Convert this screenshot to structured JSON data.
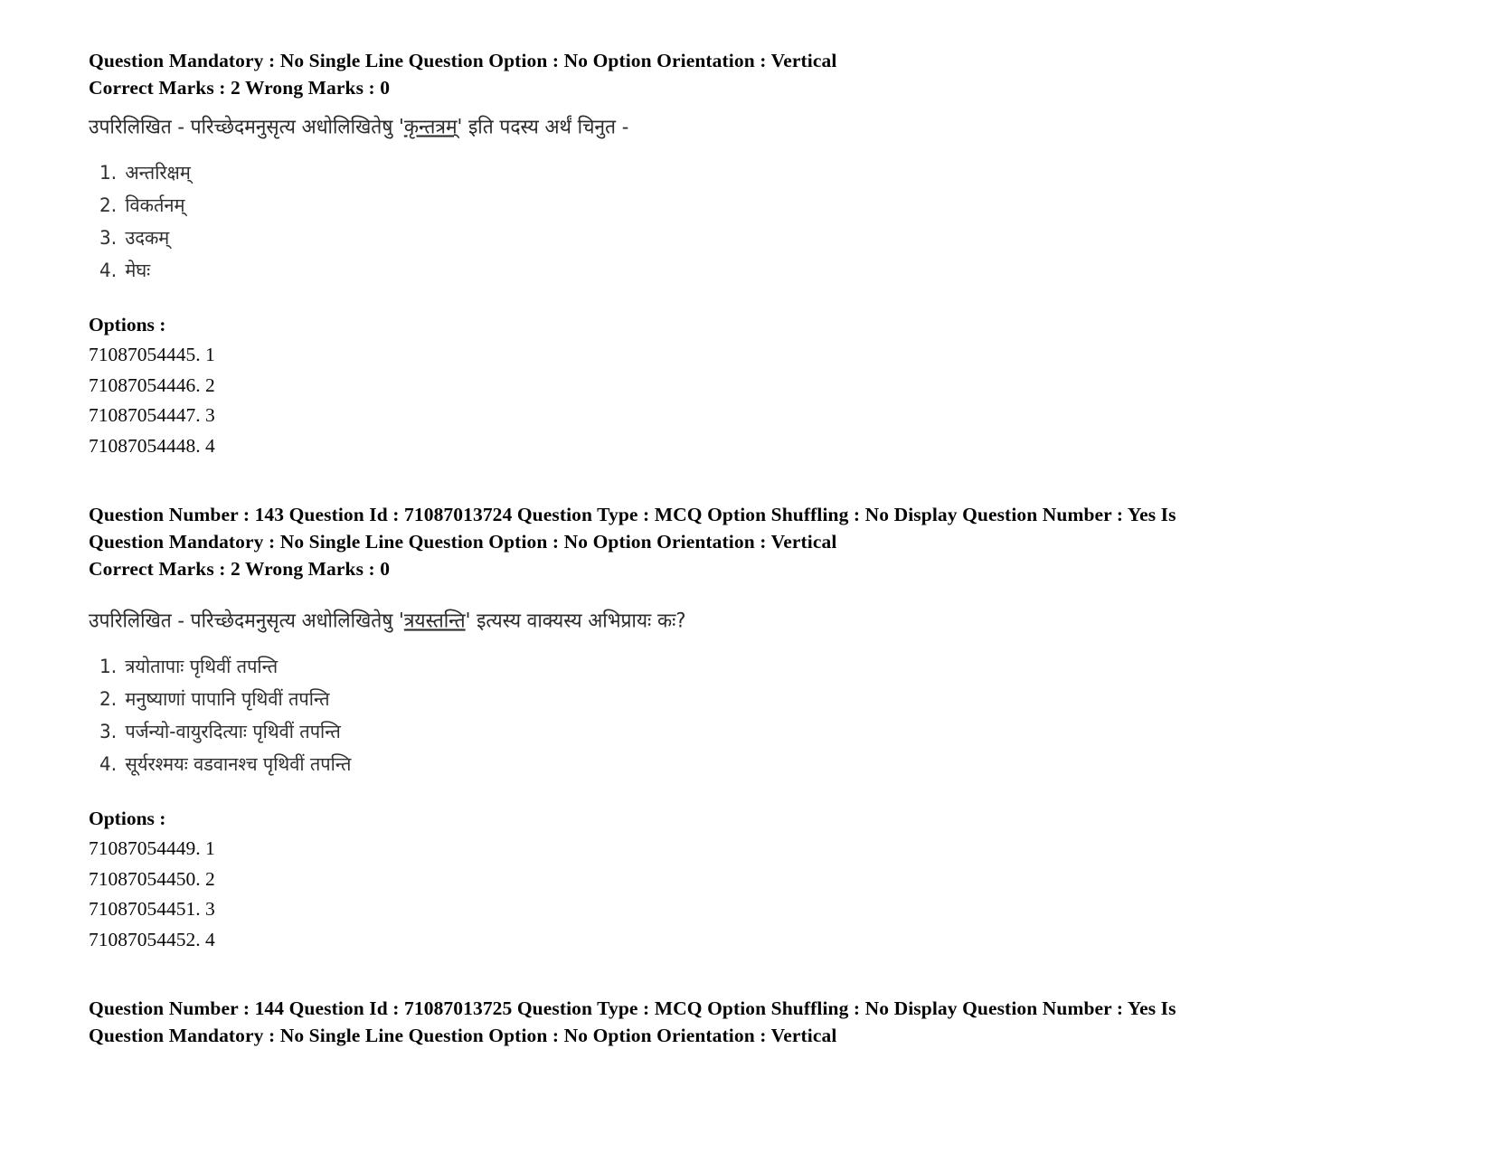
{
  "document": {
    "type": "scanned-exam-question-paper",
    "language_script": "Devanagari (Sanskrit)"
  },
  "blocks": [
    {
      "id": "question-142-tail",
      "meta_lines": [
        "Question Mandatory : No Single Line Question Option : No Option Orientation : Vertical",
        "Correct Marks : 2 Wrong Marks : 0"
      ],
      "stem_prefix": "उपरिलिखित - परिच्छेदमनुसृत्य अधोलिखितेषु '",
      "stem_quoted": "कृन्तत्रम्",
      "stem_suffix": "' इति पदस्य अर्थं चिनुत -",
      "choices": [
        {
          "num": "1.",
          "text": "अन्तरिक्षम्"
        },
        {
          "num": "2.",
          "text": "विकर्तनम्"
        },
        {
          "num": "3.",
          "text": "उदकम्"
        },
        {
          "num": "4.",
          "text": "मेघः"
        }
      ],
      "options_label": "Options :",
      "option_ids": [
        "71087054445. 1",
        "71087054446. 2",
        "71087054447. 3",
        "71087054448. 4"
      ]
    },
    {
      "id": "question-143",
      "meta_lines": [
        "Question Number : 143 Question Id : 71087013724 Question Type : MCQ Option Shuffling : No Display Question Number : Yes Is",
        "Question Mandatory : No Single Line Question Option : No Option Orientation : Vertical",
        "Correct Marks : 2 Wrong Marks : 0"
      ],
      "stem_prefix": "उपरिलिखित - परिच्छेदमनुसृत्य अधोलिखितेषु '",
      "stem_quoted": "त्रयस्तन्ति",
      "stem_suffix": "' इत्यस्य वाक्यस्य अभिप्रायः कः?",
      "choices": [
        {
          "num": "1.",
          "text": "त्रयोतापाः पृथिवीं तपन्ति"
        },
        {
          "num": "2.",
          "text": "मनुष्याणां पापानि पृथिवीं तपन्ति"
        },
        {
          "num": "3.",
          "text": "पर्जन्यो-वायुरदित्याः पृथिवीं तपन्ति"
        },
        {
          "num": "4.",
          "text": "सूर्यरश्मयः वडवानश्च पृथिवीं तपन्ति"
        }
      ],
      "options_label": "Options :",
      "option_ids": [
        "71087054449. 1",
        "71087054450. 2",
        "71087054451. 3",
        "71087054452. 4"
      ]
    },
    {
      "id": "question-144-head",
      "meta_lines": [
        "Question Number : 144 Question Id : 71087013725 Question Type : MCQ Option Shuffling : No Display Question Number : Yes Is",
        "Question Mandatory : No Single Line Question Option : No Option Orientation : Vertical"
      ],
      "choices": [],
      "option_ids": []
    }
  ]
}
